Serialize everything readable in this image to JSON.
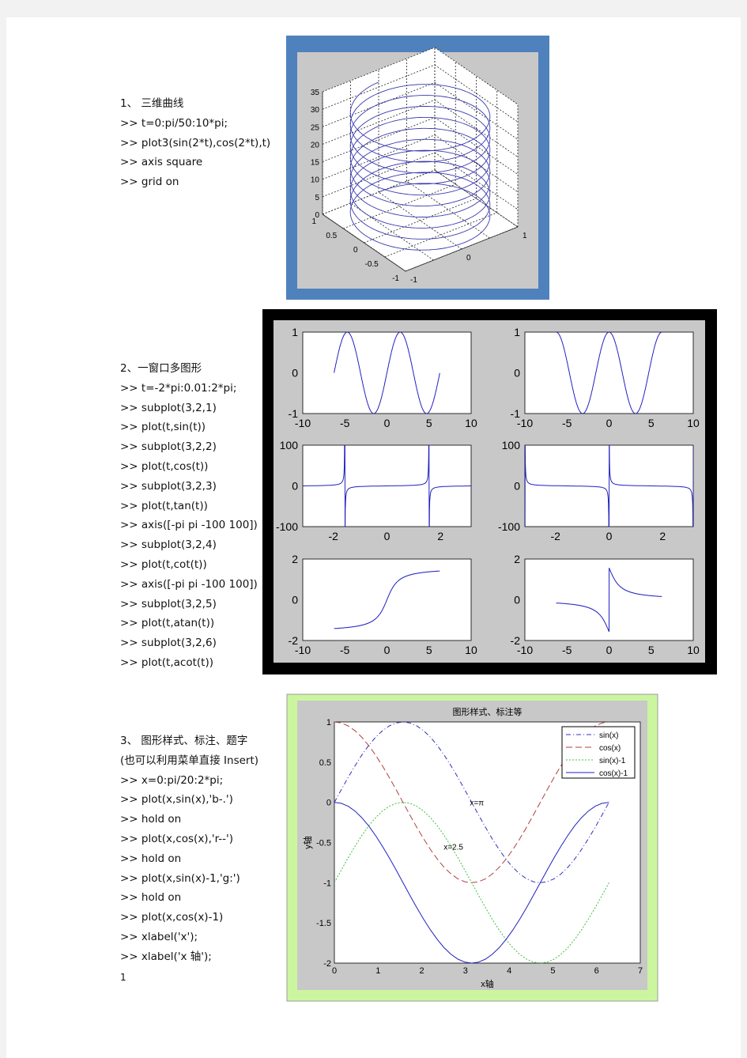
{
  "section1": {
    "lines": [
      "1、 三维曲线",
      ">> t=0:pi/50:10*pi;",
      ">> plot3(sin(2*t),cos(2*t),t)",
      ">> axis square",
      ">> grid on"
    ]
  },
  "section2": {
    "lines": [
      "2、一窗口多图形",
      ">> t=-2*pi:0.01:2*pi;",
      ">> subplot(3,2,1)",
      ">> plot(t,sin(t))",
      ">> subplot(3,2,2)",
      ">> plot(t,cos(t))",
      ">> subplot(3,2,3)",
      ">> plot(t,tan(t))",
      ">> axis([-pi pi -100 100])",
      ">> subplot(3,2,4)",
      ">> plot(t,cot(t))",
      ">> axis([-pi pi -100 100])",
      ">> subplot(3,2,5)",
      ">> plot(t,atan(t))",
      ">> subplot(3,2,6)",
      ">> plot(t,acot(t))"
    ]
  },
  "section3": {
    "lines": [
      "3、 图形样式、标注、题字",
      "(也可以利用菜单直接 Insert)",
      ">> x=0:pi/20:2*pi;",
      ">> plot(x,sin(x),'b-.')",
      ">> hold on",
      ">> plot(x,cos(x),'r--')",
      ">> hold on",
      ">> plot(x,sin(x)-1,'g:')",
      ">> hold on",
      ">> plot(x,cos(x)-1)",
      ">> xlabel('x');",
      ">> xlabel('x 轴');"
    ]
  },
  "page_number": "1",
  "colors": {
    "fig1_frame": "#4f81bd",
    "fig2_frame": "#000000",
    "fig3_frame": "#ccf5a0",
    "figure_bg": "#c8c8c8",
    "line_blue": "#2020c0"
  },
  "chart_data": [
    {
      "type": "line3d",
      "function": "x=sin(2t), y=cos(2t), z=t, t in [0,10π]",
      "zticks": [
        "0",
        "5",
        "10",
        "15",
        "20",
        "25",
        "30",
        "35"
      ],
      "xticks": [
        "-1",
        "0",
        "1"
      ],
      "yticks": [
        "1",
        "0.5",
        "0",
        "-0.5",
        "-1"
      ],
      "zlim": [
        0,
        35
      ],
      "grid": true
    },
    {
      "type": "line",
      "subplots": [
        {
          "fn": "sin",
          "xlim": [
            -10,
            10
          ],
          "ylim": [
            -1,
            1
          ],
          "xticks": [
            "-10",
            "-5",
            "0",
            "5",
            "10"
          ],
          "yticks": [
            "1",
            "0",
            "-1"
          ]
        },
        {
          "fn": "cos",
          "xlim": [
            -10,
            10
          ],
          "ylim": [
            -1,
            1
          ],
          "xticks": [
            "-10",
            "-5",
            "0",
            "5",
            "10"
          ],
          "yticks": [
            "1",
            "0",
            "-1"
          ]
        },
        {
          "fn": "tan",
          "xlim": [
            -3.1416,
            3.1416
          ],
          "ylim": [
            -100,
            100
          ],
          "xticks": [
            "-2",
            "0",
            "2"
          ],
          "yticks": [
            "100",
            "0",
            "-100"
          ]
        },
        {
          "fn": "cot",
          "xlim": [
            -3.1416,
            3.1416
          ],
          "ylim": [
            -100,
            100
          ],
          "xticks": [
            "-2",
            "0",
            "2"
          ],
          "yticks": [
            "100",
            "0",
            "-100"
          ]
        },
        {
          "fn": "atan",
          "xlim": [
            -10,
            10
          ],
          "ylim": [
            -2,
            2
          ],
          "xticks": [
            "-10",
            "-5",
            "0",
            "5",
            "10"
          ],
          "yticks": [
            "2",
            "0",
            "-2"
          ]
        },
        {
          "fn": "acot",
          "xlim": [
            -10,
            10
          ],
          "ylim": [
            -2,
            2
          ],
          "xticks": [
            "-10",
            "-5",
            "0",
            "5",
            "10"
          ],
          "yticks": [
            "2",
            "0",
            "-2"
          ]
        }
      ]
    },
    {
      "type": "line",
      "title": "图形样式、标注等",
      "xlabel": "x轴",
      "ylabel": "y轴",
      "xlim": [
        0,
        7
      ],
      "ylim": [
        -2,
        1
      ],
      "xticks": [
        "0",
        "1",
        "2",
        "3",
        "4",
        "5",
        "6",
        "7"
      ],
      "yticks": [
        "1",
        "0.5",
        "0",
        "-0.5",
        "-1",
        "-1.5",
        "-2"
      ],
      "series": [
        {
          "name": "sin(x)",
          "style": "-.",
          "color": "#3030c0"
        },
        {
          "name": "cos(x)",
          "style": "--",
          "color": "#b04040"
        },
        {
          "name": "sin(x)-1",
          "style": ":",
          "color": "#40c040"
        },
        {
          "name": "cos(x)-1",
          "style": "-",
          "color": "#2020c0"
        }
      ],
      "legend": "top-right",
      "annotations": [
        {
          "text": "x=π",
          "x": 3.1,
          "y": 0
        },
        {
          "text": "x=2.5",
          "x": 2.5,
          "y": -0.55
        }
      ]
    }
  ]
}
